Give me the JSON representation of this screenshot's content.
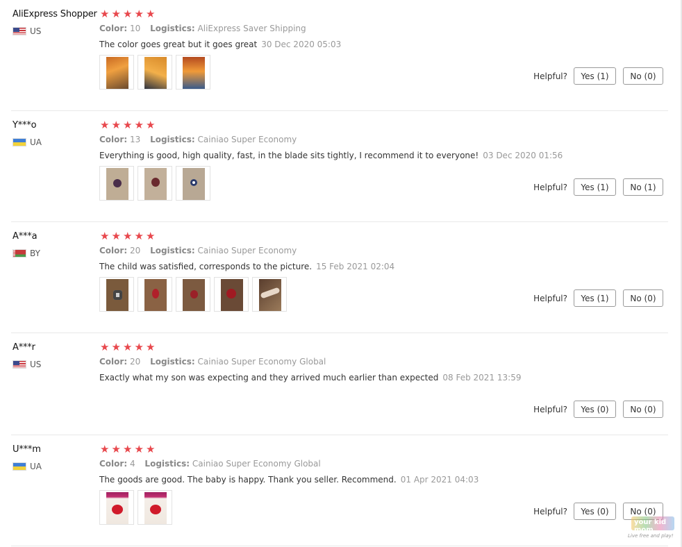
{
  "colors": {
    "star": "#e8484d",
    "border": "#e8e8e8",
    "meta": "#999999"
  },
  "labels": {
    "color_key": "Color:",
    "logistics_key": "Logistics:",
    "helpful": "Helpful?"
  },
  "reviews": [
    {
      "user": "AliExpress Shopper",
      "country": "US",
      "flag": "us-flag-icon",
      "rating": 5,
      "color": "10",
      "logistics": "AliExpress Saver Shipping",
      "text": "The color goes great but it goes great",
      "date": "30 Dec 2020 05:03",
      "photos": [
        "product-photo-1",
        "product-photo-2",
        "product-photo-3"
      ],
      "yes": "Yes (1)",
      "no": "No (0)"
    },
    {
      "user": "Y***o",
      "country": "UA",
      "flag": "ua-flag-icon",
      "rating": 5,
      "color": "13",
      "logistics": "Cainiao Super Economy",
      "text": "Everything is good, high quality, fast, in the blade sits tightly, I recommend it to everyone!",
      "date": "03 Dec 2020 01:56",
      "photos": [
        "product-photo-1",
        "product-photo-2",
        "product-photo-3"
      ],
      "yes": "Yes (1)",
      "no": "No (1)"
    },
    {
      "user": "A***a",
      "country": "BY",
      "flag": "by-flag-icon",
      "rating": 5,
      "color": "20",
      "logistics": "Cainiao Super Economy",
      "text": "The child was satisfied, corresponds to the picture.",
      "date": "15 Feb 2021 02:04",
      "photos": [
        "product-photo-1",
        "product-photo-2",
        "product-photo-3",
        "product-photo-4",
        "product-photo-5"
      ],
      "yes": "Yes (1)",
      "no": "No (0)"
    },
    {
      "user": "A***r",
      "country": "US",
      "flag": "us-flag-icon",
      "rating": 5,
      "color": "20",
      "logistics": "Cainiao Super Economy Global",
      "text": "Exactly what my son was expecting and they arrived much earlier than expected",
      "date": "08 Feb 2021 13:59",
      "photos": [],
      "yes": "Yes (0)",
      "no": "No (0)"
    },
    {
      "user": "U***m",
      "country": "UA",
      "flag": "ua-flag-icon",
      "rating": 5,
      "color": "4",
      "logistics": "Cainiao Super Economy Global",
      "text": "The goods are good. The baby is happy. Thank you seller. Recommend.",
      "date": "01 Apr 2021 04:03",
      "photos": [
        "product-photo-1",
        "product-photo-2"
      ],
      "yes": "Yes (0)",
      "no": "No (0)"
    }
  ],
  "watermark": {
    "title": "your kid mom",
    "tagline": "Live free and play!"
  }
}
